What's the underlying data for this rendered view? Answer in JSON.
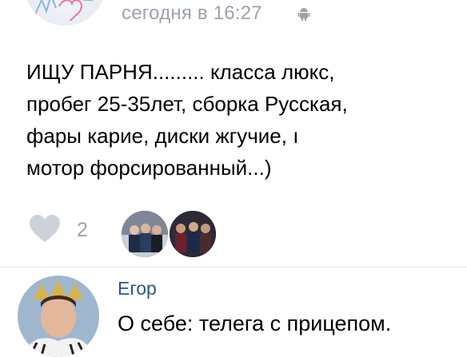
{
  "post": {
    "timestamp": "сегодня в 16:27",
    "platform_icon": "android-icon",
    "text_lines": [
      "ИЩУ ПАРНЯ......... класса люкс,",
      "пробег 25-35лет, сборка Русская,",
      "фары карие, диски  жгучие, ı",
      "мотор форсированный...)"
    ]
  },
  "reactions": {
    "like_icon": "heart-icon",
    "like_count": "2"
  },
  "comment": {
    "author": "Егор",
    "text": "О себе: телега с прицепом."
  },
  "colors": {
    "link": "#2a5885",
    "secondary_text": "#9aa3ad",
    "heart": "#cdd2d8",
    "divider": "#e3e6ea"
  }
}
